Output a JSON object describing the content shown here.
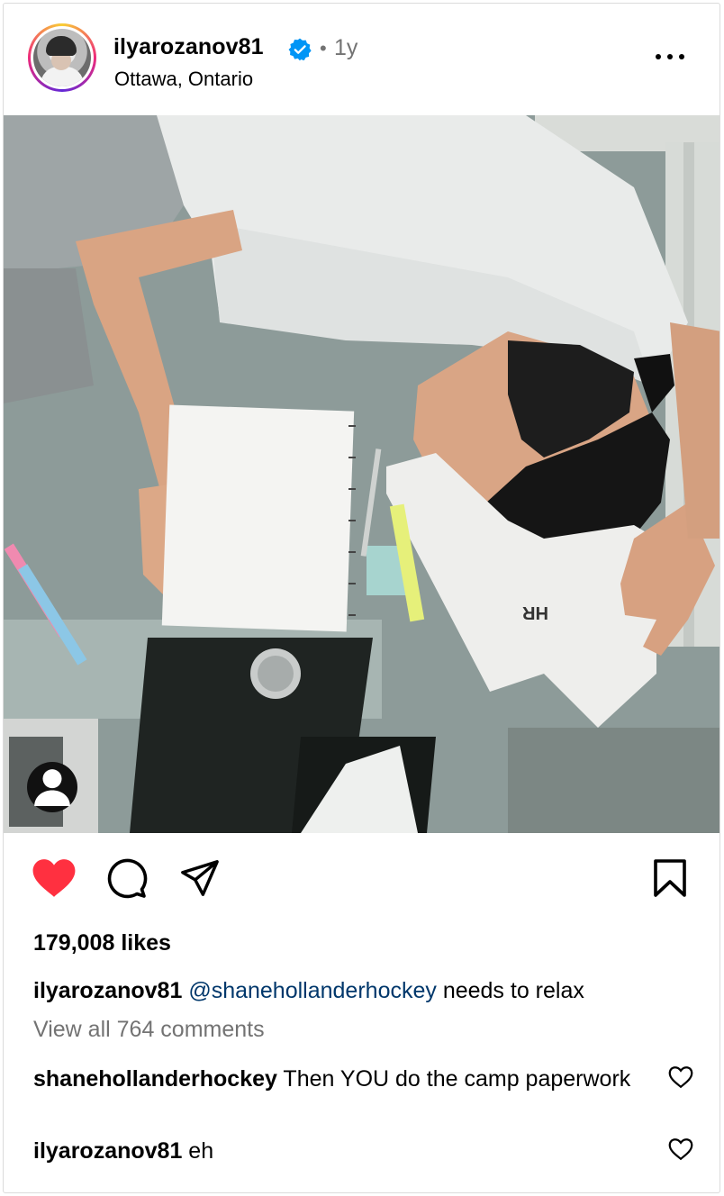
{
  "post": {
    "username": "ilyarozanov81",
    "verified": true,
    "dot": "•",
    "time_ago": "1y",
    "location": "Ottawa, Ontario"
  },
  "icons": {
    "verified": "verified-badge-icon",
    "more": "more-options-icon",
    "user_tag": "user-tag-icon",
    "like": "heart-filled-icon",
    "comment": "comment-bubble-icon",
    "share": "paper-plane-icon",
    "save": "bookmark-icon",
    "comment_like": "heart-outline-icon"
  },
  "colors": {
    "like_red": "#ff3040",
    "verified_blue": "#0095f6",
    "mention_blue": "#00376b",
    "secondary_text": "#737373",
    "border": "#dbdbdb"
  },
  "engagement": {
    "likes_text": "179,008 likes",
    "liked": true,
    "saved": false
  },
  "caption": {
    "user": "ilyarozanov81",
    "mention": "@shanehollanderhockey",
    "text": " needs to relax"
  },
  "view_comments_text": "View all 764 comments",
  "comments": [
    {
      "user": "shanehollanderhockey",
      "text": " Then YOU do the camp paperwork"
    },
    {
      "user": "ilyarozanov81",
      "text": " eh"
    }
  ]
}
